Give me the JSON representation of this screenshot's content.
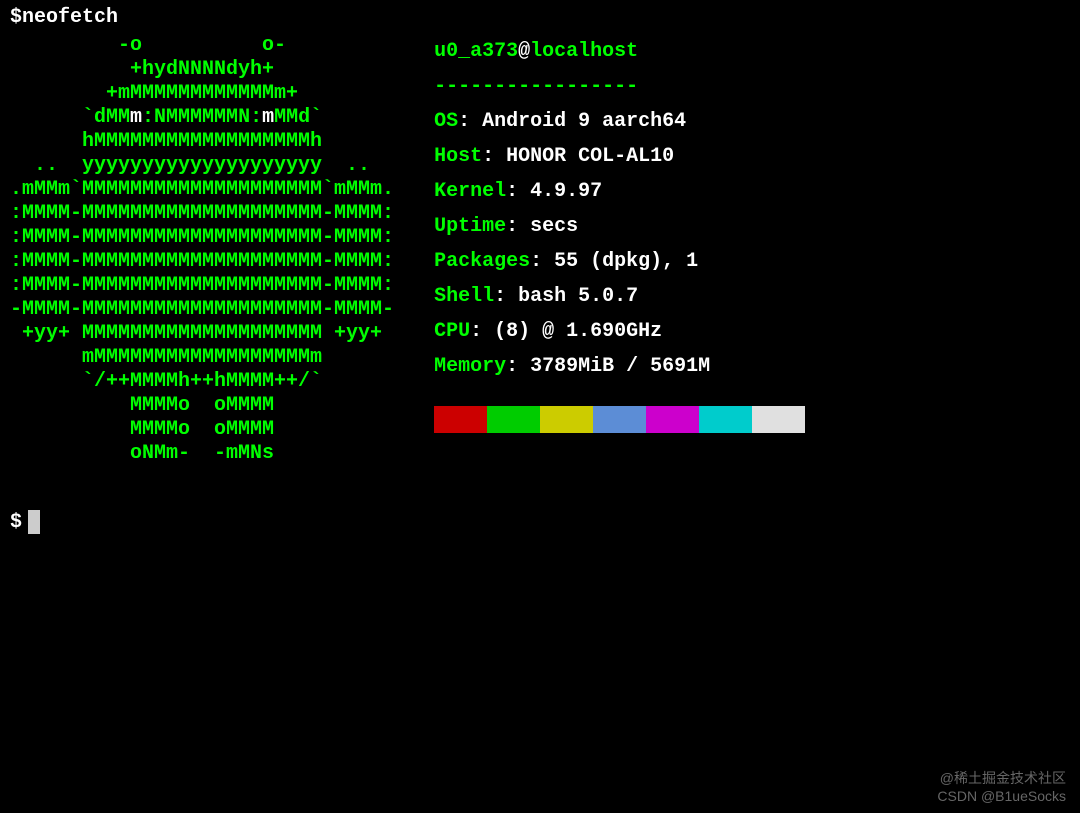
{
  "prompt": "$ ",
  "command": "neofetch",
  "ascii_lines": [
    "         -o          o-",
    "          +hydNNNNdyh+",
    "        +mMMMMMMMMMMMMm+",
    "      `dMMm:NMMMMMMN:mMMd`",
    "      hMMMMMMMMMMMMMMMMMMh",
    "  ..  yyyyyyyyyyyyyyyyyyyy  ..",
    ".mMMm`MMMMMMMMMMMMMMMMMMMM`mMMm.",
    ":MMMM-MMMMMMMMMMMMMMMMMMMM-MMMM:",
    ":MMMM-MMMMMMMMMMMMMMMMMMMM-MMMM:",
    ":MMMM-MMMMMMMMMMMMMMMMMMMM-MMMM:",
    ":MMMM-MMMMMMMMMMMMMMMMMMMM-MMMM:",
    "-MMMM-MMMMMMMMMMMMMMMMMMMM-MMMM-",
    " +yy+ MMMMMMMMMMMMMMMMMMMM +yy+",
    "      mMMMMMMMMMMMMMMMMMMm",
    "      `/++MMMMh++hMMMM++/`",
    "          MMMMo  oMMMM",
    "          MMMMo  oMMMM",
    "          oNMm-  -mMNs"
  ],
  "user": "u0_a373",
  "at": "@",
  "host": "localhost",
  "dashes": "-----------------",
  "rows": [
    {
      "label": "OS",
      "value": "Android 9 aarch64"
    },
    {
      "label": "Host",
      "value": "HONOR COL-AL10"
    },
    {
      "label": "Kernel",
      "value": "4.9.97"
    },
    {
      "label": "Uptime",
      "value": "secs"
    },
    {
      "label": "Packages",
      "value": "55 (dpkg), 1"
    },
    {
      "label": "Shell",
      "value": "bash 5.0.7"
    },
    {
      "label": "CPU",
      "value": "(8) @ 1.690GHz"
    },
    {
      "label": "Memory",
      "value": "3789MiB / 5691M"
    }
  ],
  "colors": [
    "#cc0000",
    "#00cc00",
    "#cccc00",
    "#5c8dd6",
    "#cc00cc",
    "#00cccc",
    "#e0e0e0"
  ],
  "prompt2": "$",
  "watermark1": "@稀土掘金技术社区",
  "watermark2": "CSDN @B1ueSocks"
}
